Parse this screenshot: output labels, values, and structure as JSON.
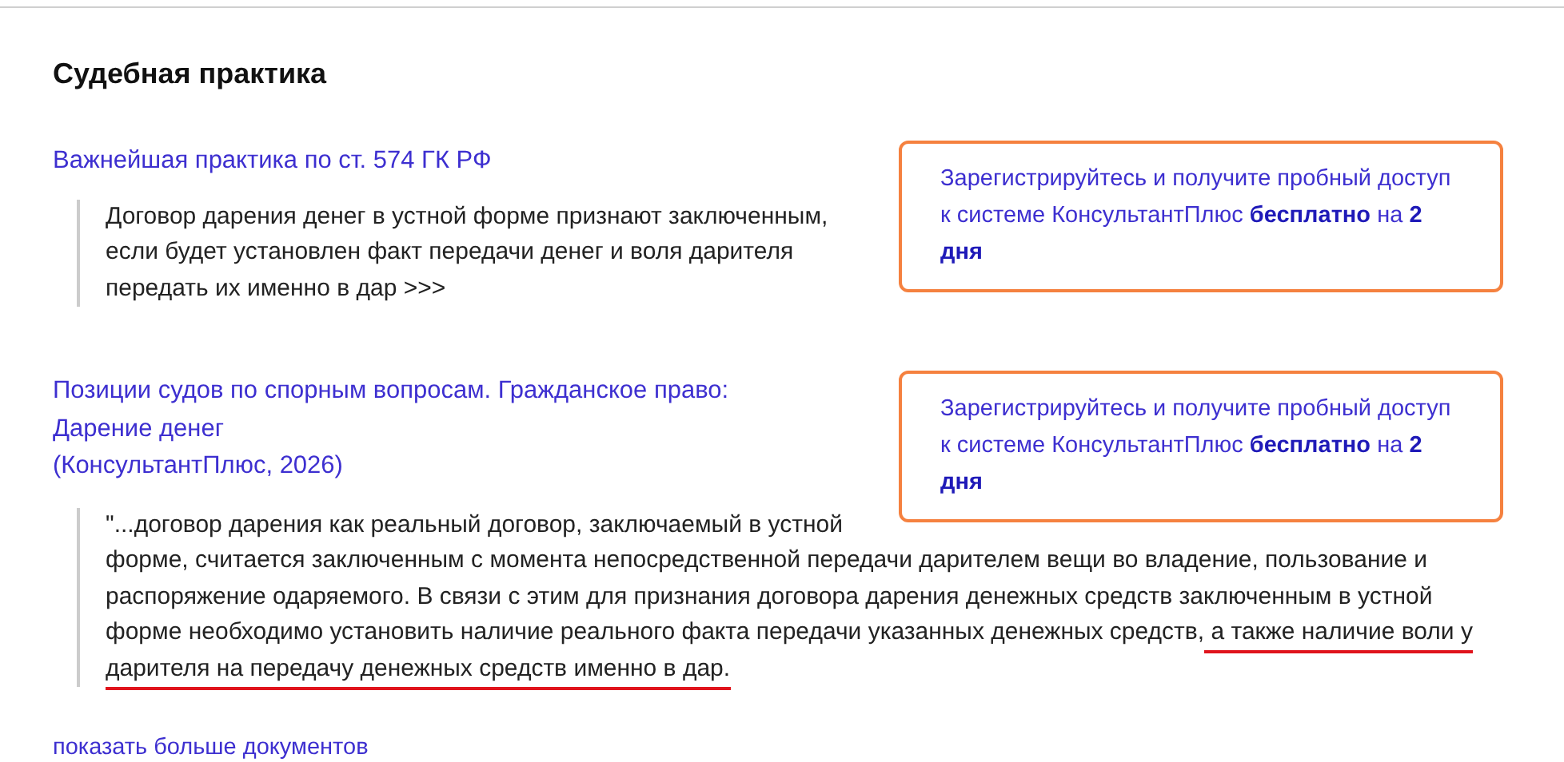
{
  "section_title": "Судебная практика",
  "items": [
    {
      "title_lines": [
        "Важнейшая практика по ст. 574 ГК РФ"
      ],
      "quote_lines": [
        [
          {
            "text": "Договор дарения денег в устной форме признают заключенным,",
            "marked": false
          }
        ],
        [
          {
            "text": "если будет установлен факт передачи денег и воля дарителя",
            "marked": false
          }
        ],
        [
          {
            "text": "передать их именно в дар >>>",
            "marked": false
          }
        ]
      ],
      "promo": "Зарегистрируйтесь и получите пробный доступ к системе КонсультантПлюс **бесплатно** на **2 дня**"
    },
    {
      "title_lines": [
        "Позиции судов по спорным вопросам. Гражданское право:",
        "Дарение денег",
        "(КонсультантПлюс, 2026)"
      ],
      "quote_lines": [
        [
          {
            "text": "\"...договор дарения как реальный договор, заключаемый в устной",
            "marked": false
          }
        ],
        [
          {
            "text": "форме, считается заключенным с момента непосредственной передачи дарителем вещи во владение, пользование и",
            "marked": false
          }
        ],
        [
          {
            "text": "распоряжение одаряемого. В связи с этим для признания договора дарения денежных средств заключенным в устной",
            "marked": false
          }
        ],
        [
          {
            "text": "форме необходимо установить наличие реального факта передачи указанных денежных средств,",
            "marked": false
          },
          {
            "text": " а также наличие воли у",
            "marked": true
          }
        ],
        [
          {
            "text": "дарителя на передачу денежных средств именно в дар.",
            "marked": true
          }
        ]
      ],
      "promo": "Зарегистрируйтесь и получите пробный доступ к системе КонсультантПлюс **бесплатно** на **2 дня**"
    }
  ],
  "more_link": "показать больше документов"
}
